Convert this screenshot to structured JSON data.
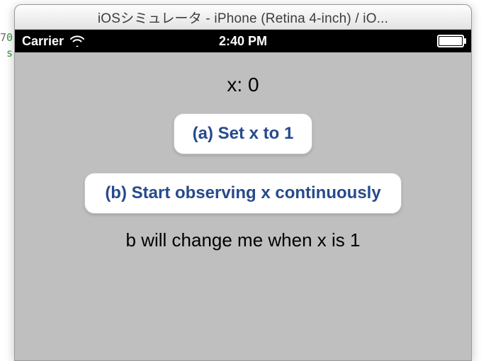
{
  "gutter": {
    "first": "7",
    "zero": "0",
    "second": "s"
  },
  "window": {
    "title": "iOSシミュレータ - iPhone (Retina 4-inch) / iO..."
  },
  "statusbar": {
    "carrier": "Carrier",
    "time": "2:40 PM"
  },
  "app": {
    "x_label": "x: 0",
    "button_a": "(a) Set x to 1",
    "button_b": "(b) Start observing x continuously",
    "hint": "b will change me when x is 1"
  }
}
